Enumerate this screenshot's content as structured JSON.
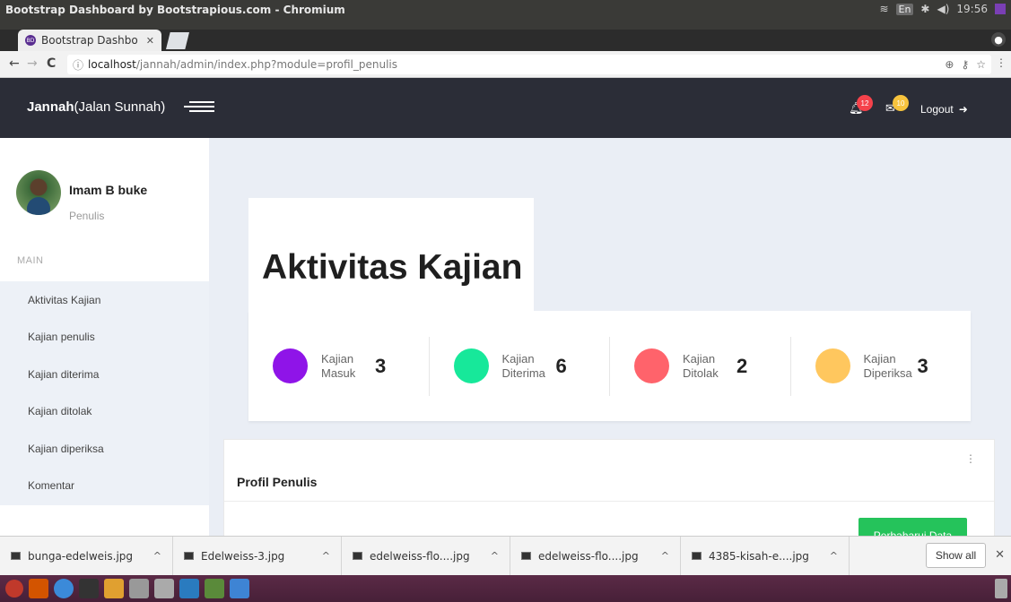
{
  "window": {
    "title": "Bootstrap Dashboard by Bootstrapious.com - Chromium",
    "tray": {
      "language": "En",
      "time": "19:56"
    }
  },
  "browser": {
    "tab_title": "Bootstrap Dashbo",
    "tab_favicon": "BD",
    "url_host": "localhost",
    "url_path": "/jannah/admin/index.php?module=profil_penulis"
  },
  "topbar": {
    "brand_bold": "Jannah",
    "brand_rest": "(Jalan Sunnah)",
    "notifications_count": "12",
    "messages_count": "10",
    "logout_label": "Logout"
  },
  "sidebar": {
    "user_name": "Imam B buke",
    "user_role": "Penulis",
    "section_label": "MAIN",
    "items": [
      {
        "label": "Aktivitas Kajian"
      },
      {
        "label": "Kajian penulis"
      },
      {
        "label": "Kajian diterima"
      },
      {
        "label": "Kajian ditolak"
      },
      {
        "label": "Kajian diperiksa"
      },
      {
        "label": "Komentar"
      }
    ]
  },
  "main": {
    "heading": "Aktivitas Kajian",
    "stats": [
      {
        "line1": "Kajian",
        "line2": "Masuk",
        "value": "3",
        "color": "#8f14e8"
      },
      {
        "line1": "Kajian",
        "line2": "Diterima",
        "value": "6",
        "color": "#17e89a"
      },
      {
        "line1": "Kajian",
        "line2": "Ditolak",
        "value": "2",
        "color": "#ff636b"
      },
      {
        "line1": "Kajian",
        "line2": "Diperiksa",
        "value": "3",
        "color": "#ffc75e"
      }
    ],
    "profile": {
      "title": "Profil Penulis",
      "update_button": "Perbaharui Data"
    }
  },
  "downloads": {
    "items": [
      {
        "name": "bunga-edelweis.jpg"
      },
      {
        "name": "Edelweiss-3.jpg"
      },
      {
        "name": "edelweiss-flo....jpg"
      },
      {
        "name": "edelweiss-flo....jpg"
      },
      {
        "name": "4385-kisah-e....jpg"
      }
    ],
    "show_all": "Show all"
  },
  "colors": {
    "topbar": "#2b2d37",
    "accent_green": "#25c35b"
  }
}
